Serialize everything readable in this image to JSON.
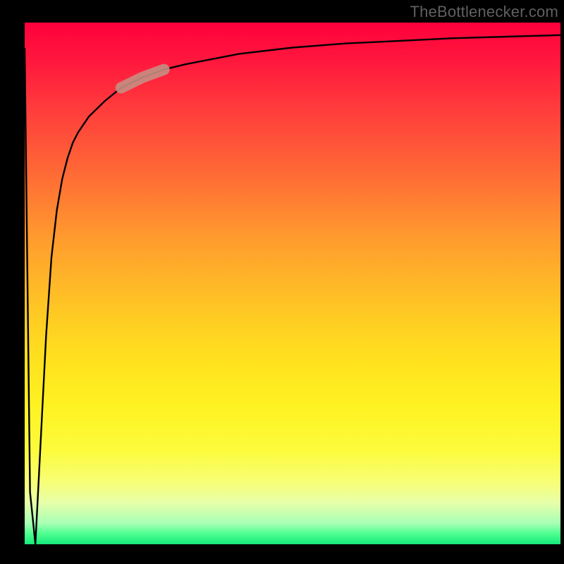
{
  "watermark": "TheBottlenecker.com",
  "chart_data": {
    "type": "line",
    "title": "",
    "xlabel": "",
    "ylabel": "",
    "xlim": [
      0,
      100
    ],
    "ylim": [
      0,
      100
    ],
    "series": [
      {
        "name": "curve",
        "x": [
          0,
          1,
          2,
          3,
          4,
          5,
          6,
          7,
          8,
          9,
          10,
          12,
          15,
          18,
          22,
          26,
          30,
          35,
          40,
          50,
          60,
          70,
          80,
          90,
          100
        ],
        "y": [
          95,
          10,
          0,
          20,
          40,
          55,
          64,
          70,
          74,
          77,
          79,
          82,
          85,
          87.5,
          89.5,
          91,
          92,
          93,
          94,
          95.2,
          96,
          96.5,
          97,
          97.3,
          97.6
        ]
      }
    ],
    "highlight_segment": {
      "x_start": 18,
      "x_end": 26
    },
    "background_gradient": {
      "stops": [
        {
          "pos": 0,
          "color": "#FF003C"
        },
        {
          "pos": 50,
          "color": "#FFB728"
        },
        {
          "pos": 82,
          "color": "#FCFB3C"
        },
        {
          "pos": 100,
          "color": "#16E97C"
        }
      ]
    }
  }
}
